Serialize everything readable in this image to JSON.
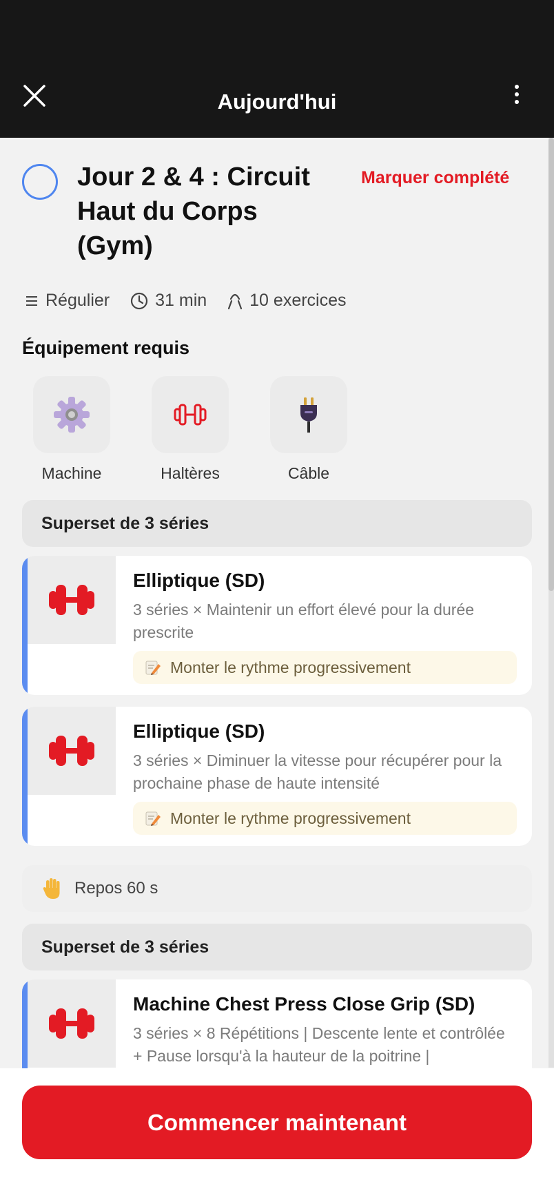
{
  "header": {
    "title": "Aujourd'hui"
  },
  "workout": {
    "title": "Jour 2 & 4 : Circuit Haut du Corps (Gym)",
    "mark_complete": "Marquer complété",
    "meta": {
      "level": "Régulier",
      "duration": "31 min",
      "exercises": "10 exercices"
    }
  },
  "equipment": {
    "title": "Équipement requis",
    "items": [
      {
        "label": "Machine",
        "icon": "gear-icon"
      },
      {
        "label": "Haltères",
        "icon": "dumbbell-icon"
      },
      {
        "label": "Câble",
        "icon": "plug-icon"
      }
    ]
  },
  "supersets": [
    {
      "label": "Superset de 3 séries",
      "exercises": [
        {
          "name": "Elliptique (SD)",
          "desc": "3 séries × Maintenir un effort élevé pour la durée prescrite",
          "note": "Monter le rythme progressivement"
        },
        {
          "name": "Elliptique (SD)",
          "desc": "3 séries × Diminuer la vitesse pour récupérer pour la prochaine phase de haute intensité",
          "note": "Monter le rythme progressivement"
        }
      ]
    },
    {
      "label": "Superset de 3 séries",
      "exercises": [
        {
          "name": "Machine Chest Press Close Grip (SD)",
          "desc": "3 séries × 8 Répétitions | Descente lente et contrôlée + Pause lorsqu'à la hauteur de la poitrine |"
        }
      ]
    }
  ],
  "rest": {
    "label": "Repos 60 s"
  },
  "cta": {
    "label": "Commencer maintenant"
  },
  "colors": {
    "accent_red": "#e31b24",
    "accent_blue": "#5b8cf0",
    "header_bg": "#171717"
  }
}
